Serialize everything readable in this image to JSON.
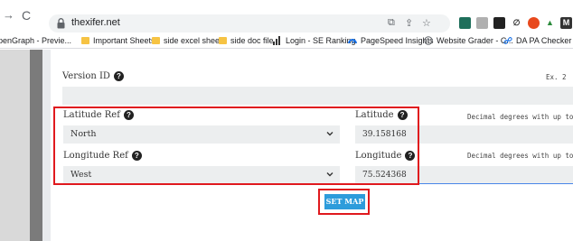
{
  "browser": {
    "url": "thexifer.net",
    "bookmarks": [
      "penGraph - Previe...",
      "Important Sheets",
      "side excel sheets",
      "side doc file",
      "Login - SE Ranking",
      "PageSpeed Insights",
      "Website Grader - C...",
      "DA PA Checker -"
    ]
  },
  "form": {
    "version_id": {
      "label": "Version ID",
      "hint": "Ex. 2"
    },
    "latitude_ref": {
      "label": "Latitude Ref",
      "value": "North"
    },
    "latitude": {
      "label": "Latitude",
      "value": "39.158168",
      "hint": "Decimal degrees with up to"
    },
    "longitude_ref": {
      "label": "Longitude Ref",
      "value": "West"
    },
    "longitude": {
      "label": "Longitude",
      "value": "75.524368",
      "hint": "Decimal degrees with up to"
    },
    "set_map_label": "SET MAP"
  },
  "colors": {
    "highlight": "#e0191e",
    "button": "#2d9cdb",
    "field_bg": "#eceeef",
    "active_underline": "#4a86e8"
  }
}
